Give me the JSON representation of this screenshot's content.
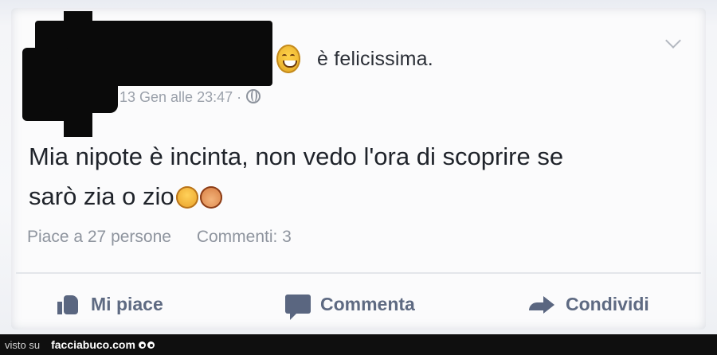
{
  "post": {
    "feeling_text": "è felicissima.",
    "timestamp": "13 Gen alle 23:47 ·",
    "body_line1": "Mia nipote è incinta, non vedo l'ora di scoprire se",
    "body_line2": "sarò zia o zio",
    "likes_text": "Piace a 27 persone",
    "comments_text": "Commenti: 3",
    "feeling_icon": "grinning-face-icon",
    "inline_emojis": [
      "grinning-face-icon",
      "face-icon"
    ]
  },
  "actions": {
    "like_label": "Mi piace",
    "comment_label": "Commenta",
    "share_label": "Condividi"
  },
  "footer": {
    "prefix": "visto su",
    "brand": "facciabuco.com"
  },
  "colors": {
    "action_text": "#5e6a82",
    "meta_text": "#9ba1ab",
    "footer_bg": "#0f0f0f"
  }
}
